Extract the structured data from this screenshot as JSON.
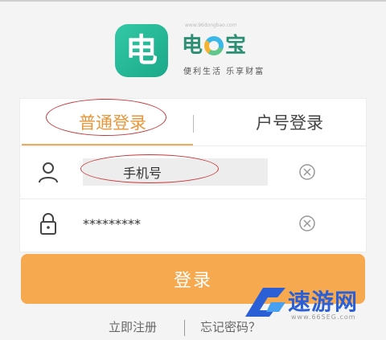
{
  "app": {
    "icon_char": "电",
    "brand_part1": "电",
    "brand_part3": "宝",
    "slogan": "便利生活 乐享财富",
    "url_text": "www.96dongbao.com"
  },
  "tabs": [
    {
      "label": "普通登录",
      "active": true
    },
    {
      "label": "户号登录",
      "active": false
    }
  ],
  "fields": {
    "phone": {
      "placeholder": "手机号",
      "value": ""
    },
    "password": {
      "value": "*********"
    }
  },
  "login_button": "登录",
  "links": {
    "register": "立即注册",
    "forgot": "忘记密码？"
  },
  "watermark": {
    "name": "速游网",
    "url": "www.66SEG.com"
  },
  "colors": {
    "accent": "#f7a94f",
    "active_tab": "#e8963a",
    "annotation": "#c7373a"
  }
}
